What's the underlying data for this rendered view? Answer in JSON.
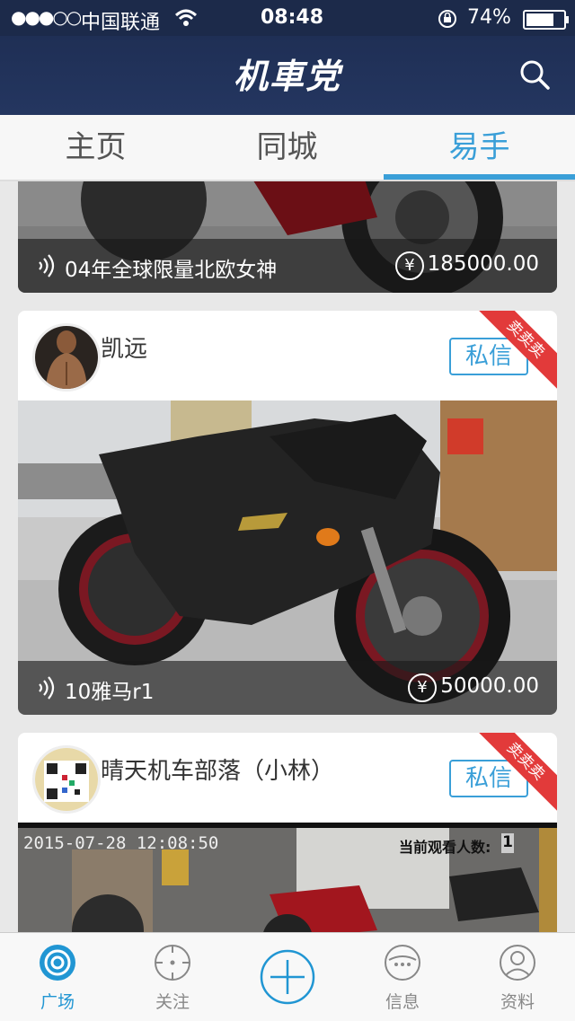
{
  "status_bar": {
    "signal": "●●●○○",
    "carrier": "中国联通",
    "time": "08:48",
    "battery": "74%"
  },
  "header": {
    "app_title": "机車党"
  },
  "tabs": [
    {
      "label": "主页"
    },
    {
      "label": "同城"
    },
    {
      "label": "易手"
    }
  ],
  "listings": [
    {
      "title": "04年全球限量北欧女神",
      "price": "185000.00",
      "currency_symbol": "¥"
    },
    {
      "user": "凯远",
      "badge": "卖卖卖",
      "action": "私信",
      "title": "10雅马r1",
      "price": "50000.00",
      "currency_symbol": "¥"
    },
    {
      "user": "晴天机车部落（小林）",
      "badge": "卖卖卖",
      "action": "私信",
      "video_timestamp": "2015-07-28  12:08:50",
      "viewer_label": "当前观看人数:",
      "viewer_count": "1"
    }
  ],
  "bottom_nav": [
    {
      "label": "广场",
      "icon": "target-icon"
    },
    {
      "label": "关注",
      "icon": "crosshair-icon"
    },
    {
      "label": "",
      "icon": "plus-icon"
    },
    {
      "label": "信息",
      "icon": "message-icon"
    },
    {
      "label": "资料",
      "icon": "profile-icon"
    }
  ],
  "colors": {
    "accent": "#3a9fd8",
    "header": "#1f2f55",
    "ribbon": "#e23a3a"
  }
}
